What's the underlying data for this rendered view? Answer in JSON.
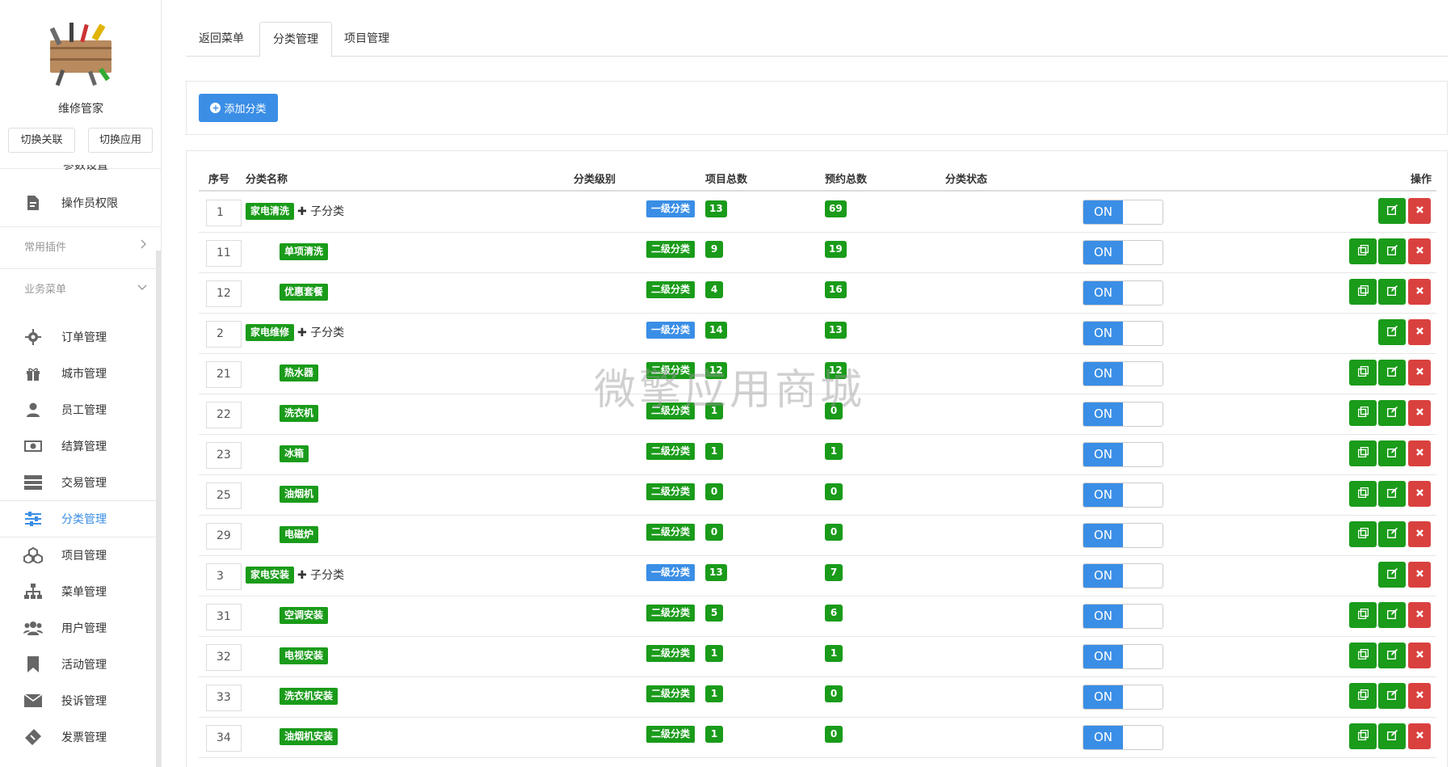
{
  "sidebar": {
    "app_name": "维修管家",
    "switch_relation": "切换关联",
    "switch_app": "切换应用",
    "partial_item": "参数设置",
    "admin_perm": "操作员权限",
    "section_common": "常用插件",
    "section_business": "业务菜单",
    "items": [
      {
        "label": "订单管理",
        "icon": "gear-icon"
      },
      {
        "label": "城市管理",
        "icon": "gift-icon"
      },
      {
        "label": "员工管理",
        "icon": "user-icon"
      },
      {
        "label": "结算管理",
        "icon": "money-icon"
      },
      {
        "label": "交易管理",
        "icon": "server-icon"
      },
      {
        "label": "分类管理",
        "icon": "sliders-icon"
      },
      {
        "label": "项目管理",
        "icon": "cubes-icon"
      },
      {
        "label": "菜单管理",
        "icon": "sitemap-icon"
      },
      {
        "label": "用户管理",
        "icon": "users-icon"
      },
      {
        "label": "活动管理",
        "icon": "bookmark-icon"
      },
      {
        "label": "投诉管理",
        "icon": "envelope-icon"
      },
      {
        "label": "发票管理",
        "icon": "ticket-icon"
      }
    ]
  },
  "tabs": [
    {
      "label": "返回菜单"
    },
    {
      "label": "分类管理"
    },
    {
      "label": "项目管理"
    }
  ],
  "add_button": "添加分类",
  "table": {
    "headers": {
      "order": "序号",
      "name": "分类名称",
      "level": "分类级别",
      "items": "项目总数",
      "bookings": "预约总数",
      "status": "分类状态",
      "actions": "操作"
    },
    "sub_add": "✚ 子分类",
    "toggle_on": "ON",
    "rows": [
      {
        "order": "1",
        "name": "家电清洗",
        "level": "一级分类",
        "items": "13",
        "bookings": "69"
      },
      {
        "order": "11",
        "name": "单项清洗",
        "level": "二级分类",
        "items": "9",
        "bookings": "19"
      },
      {
        "order": "12",
        "name": "优惠套餐",
        "level": "二级分类",
        "items": "4",
        "bookings": "16"
      },
      {
        "order": "2",
        "name": "家电维修",
        "level": "一级分类",
        "items": "14",
        "bookings": "13"
      },
      {
        "order": "21",
        "name": "热水器",
        "level": "二级分类",
        "items": "12",
        "bookings": "12"
      },
      {
        "order": "22",
        "name": "洗衣机",
        "level": "二级分类",
        "items": "1",
        "bookings": "0"
      },
      {
        "order": "23",
        "name": "冰箱",
        "level": "二级分类",
        "items": "1",
        "bookings": "1"
      },
      {
        "order": "25",
        "name": "油烟机",
        "level": "二级分类",
        "items": "0",
        "bookings": "0"
      },
      {
        "order": "29",
        "name": "电磁炉",
        "level": "二级分类",
        "items": "0",
        "bookings": "0"
      },
      {
        "order": "3",
        "name": "家电安装",
        "level": "一级分类",
        "items": "13",
        "bookings": "7"
      },
      {
        "order": "31",
        "name": "空调安装",
        "level": "二级分类",
        "items": "5",
        "bookings": "6"
      },
      {
        "order": "32",
        "name": "电视安装",
        "level": "二级分类",
        "items": "1",
        "bookings": "1"
      },
      {
        "order": "33",
        "name": "洗衣机安装",
        "level": "二级分类",
        "items": "1",
        "bookings": "0"
      },
      {
        "order": "34",
        "name": "油烟机安装",
        "level": "二级分类",
        "items": "1",
        "bookings": "0"
      }
    ]
  },
  "watermark": "微擎应用商城",
  "colors": {
    "primary": "#3a8ee6",
    "success": "#1a9b1a",
    "danger": "#d9413f"
  }
}
